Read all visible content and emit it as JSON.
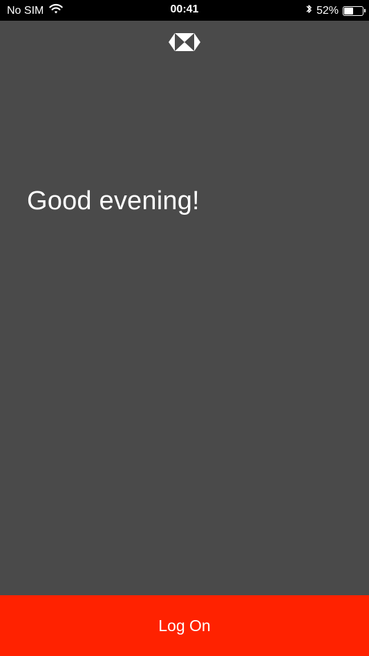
{
  "status_bar": {
    "carrier": "No SIM",
    "time": "00:41",
    "battery_percent_label": "52%",
    "battery_level": 0.52,
    "icons": [
      "wifi-icon",
      "bluetooth-icon",
      "battery-icon"
    ]
  },
  "brand": {
    "logo": "hexagon-logo",
    "logo_color": "#ffffff"
  },
  "main": {
    "greeting": "Good evening!"
  },
  "footer": {
    "logon_label": "Log On",
    "button_color": "#ff2200"
  },
  "colors": {
    "background": "#4a4a4a",
    "status_bar": "#000000",
    "text": "#ffffff"
  }
}
